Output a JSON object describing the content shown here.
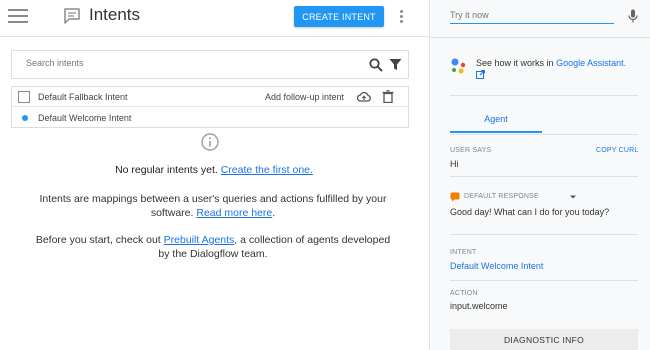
{
  "header": {
    "title": "Intents",
    "create_button": "CREATE INTENT",
    "menu_icon": "hamburger-menu-icon",
    "more_icon": "more-vert-icon"
  },
  "search": {
    "placeholder": "Search intents"
  },
  "intents": {
    "rows": [
      {
        "name": "Default Fallback Intent",
        "follow_up": "Add follow-up intent"
      },
      {
        "name": "Default Welcome Intent"
      }
    ]
  },
  "empty": {
    "message": "No regular intents yet.",
    "message_link": "Create the first one.",
    "para1_text": "Intents are mappings between a user's queries and actions fulfilled by your software.",
    "para1_link": "Read more here",
    "para1_end": ".",
    "para2_before": "Before you start, check out",
    "para2_link": "Prebuilt Agents",
    "para2_after": ", a collection of agents developed by the Dialogflow team."
  },
  "panel": {
    "try_placeholder": "Try it now",
    "assistant_text": "See how it works in",
    "assistant_link": "Google Assistant.",
    "tab": "Agent",
    "user_says_label": "USER SAYS",
    "copy_curl": "COPY CURL",
    "user_says_value": "Hi",
    "response_label": "DEFAULT RESPONSE",
    "response_value": "Good day! What can I do for you today?",
    "intent_label": "INTENT",
    "intent_value": "Default Welcome Intent",
    "action_label": "ACTION",
    "action_value": "input.welcome",
    "diagnostic_button": "DIAGNOSTIC INFO"
  },
  "colors": {
    "accent": "#2196f3",
    "link": "#1a73e8",
    "panel_bg": "#f8f9fa"
  }
}
